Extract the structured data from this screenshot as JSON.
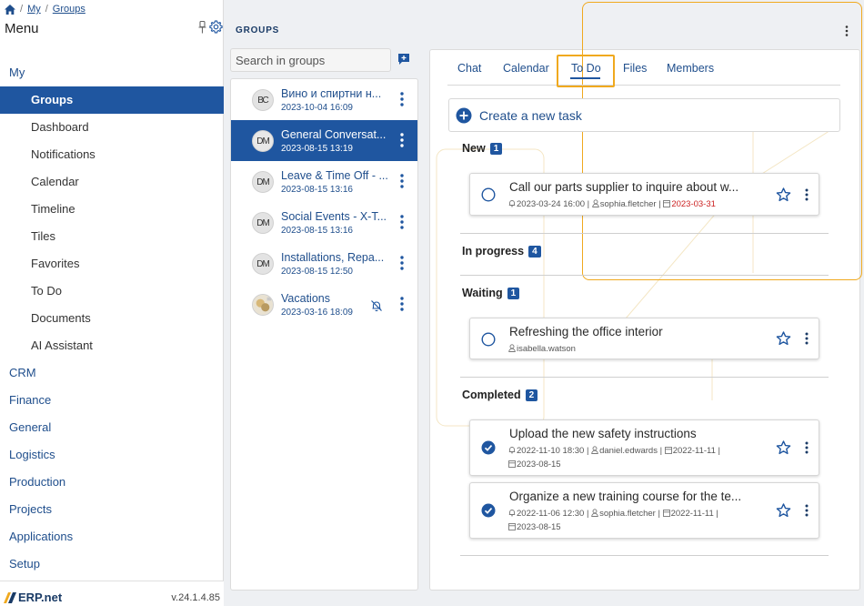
{
  "breadcrumb": {
    "home_icon": "home-icon",
    "items": [
      "My",
      "Groups"
    ]
  },
  "sidebar": {
    "title": "Menu",
    "items": [
      {
        "label": "My",
        "level": 0
      },
      {
        "label": "Groups",
        "level": 1,
        "active": true
      },
      {
        "label": "Dashboard",
        "level": 1
      },
      {
        "label": "Notifications",
        "level": 1
      },
      {
        "label": "Calendar",
        "level": 1
      },
      {
        "label": "Timeline",
        "level": 1
      },
      {
        "label": "Tiles",
        "level": 1
      },
      {
        "label": "Favorites",
        "level": 1
      },
      {
        "label": "To Do",
        "level": 1
      },
      {
        "label": "Documents",
        "level": 1
      },
      {
        "label": "AI Assistant",
        "level": 1
      },
      {
        "label": "CRM",
        "level": 0
      },
      {
        "label": "Finance",
        "level": 0
      },
      {
        "label": "General",
        "level": 0
      },
      {
        "label": "Logistics",
        "level": 0
      },
      {
        "label": "Production",
        "level": 0
      },
      {
        "label": "Projects",
        "level": 0
      },
      {
        "label": "Applications",
        "level": 0
      },
      {
        "label": "Setup",
        "level": 0
      }
    ],
    "footer": {
      "logo_text": "ERP.net",
      "version": "v.24.1.4.85"
    }
  },
  "groups": {
    "title": "GROUPS",
    "search_placeholder": "Search in groups",
    "items": [
      {
        "name": "Вино и спиртни н...",
        "date": "2023-10-04 16:09",
        "avatar": "ВС"
      },
      {
        "name": "General Conversat...",
        "date": "2023-08-15 13:19",
        "avatar": "DM",
        "selected": true
      },
      {
        "name": "Leave & Time Off - ...",
        "date": "2023-08-15 13:16",
        "avatar": "DM"
      },
      {
        "name": "Social Events - X-T...",
        "date": "2023-08-15 13:16",
        "avatar": "DM"
      },
      {
        "name": "Installations, Repa...",
        "date": "2023-08-15 12:50",
        "avatar": "DM"
      },
      {
        "name": "Vacations",
        "date": "2023-03-16 18:09",
        "avatar": "",
        "muted": true
      }
    ]
  },
  "detail": {
    "tabs": [
      "Chat",
      "Calendar",
      "To Do",
      "Files",
      "Members"
    ],
    "active_tab": "To Do",
    "create_task_label": "Create a new task",
    "sections": [
      {
        "title": "New",
        "count": "1"
      },
      {
        "title": "In progress",
        "count": "4"
      },
      {
        "title": "Waiting",
        "count": "1"
      },
      {
        "title": "Completed",
        "count": "2"
      }
    ],
    "tasks": [
      {
        "title": "Call our parts supplier to inquire about w...",
        "meta_line1": "2023-03-24 16:00 | ",
        "user": "sophia.fletcher",
        "due": "2023-03-31",
        "done": false
      },
      {
        "title": "Refreshing the office interior",
        "user": "isabella.watson",
        "done": false
      },
      {
        "title": "Upload the new safety instructions",
        "meta_line1": "2022-11-10 18:30 | ",
        "user": "daniel.edwards",
        "due": "2022-11-11",
        "due2": "2023-08-15",
        "done": true
      },
      {
        "title": "Organize a new training course for the te...",
        "meta_line1": "2022-11-06 12:30 | ",
        "user": "sophia.fletcher",
        "due": "2022-11-11",
        "due2": "2023-08-15",
        "done": true
      }
    ]
  },
  "colors": {
    "accent": "#1f56a0",
    "highlight": "#f0a91e",
    "overdue": "#cc2222"
  }
}
